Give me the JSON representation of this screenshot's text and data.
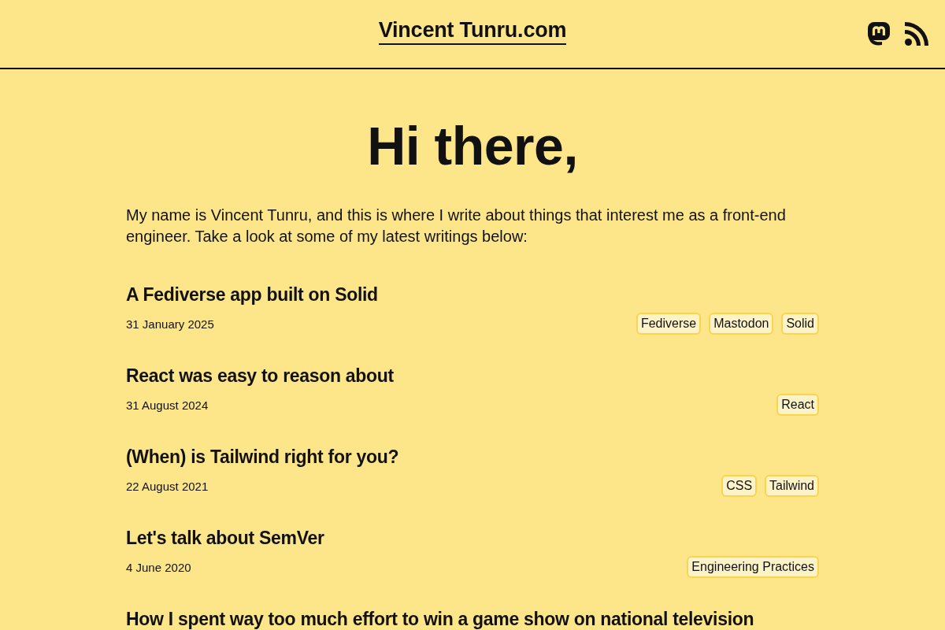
{
  "header": {
    "site_title": "Vincent Tunru.com"
  },
  "intro": {
    "heading": "Hi there,",
    "text": "My name is Vincent Tunru, and this is where I write about things that interest me as a front-end engineer. Take a look at some of my latest writings below:"
  },
  "posts": [
    {
      "title": "A Fediverse app built on Solid",
      "date": "31 January 2025",
      "tags": [
        "Fediverse",
        "Mastodon",
        "Solid"
      ]
    },
    {
      "title": "React was easy to reason about",
      "date": "31 August 2024",
      "tags": [
        "React"
      ]
    },
    {
      "title": "(When) is Tailwind right for you?",
      "date": "22 August 2021",
      "tags": [
        "CSS",
        "Tailwind"
      ]
    },
    {
      "title": "Let's talk about SemVer",
      "date": "4 June 2020",
      "tags": [
        "Engineering Practices"
      ]
    },
    {
      "title": "How I spent way too much effort to win a game show on national television"
    }
  ]
}
